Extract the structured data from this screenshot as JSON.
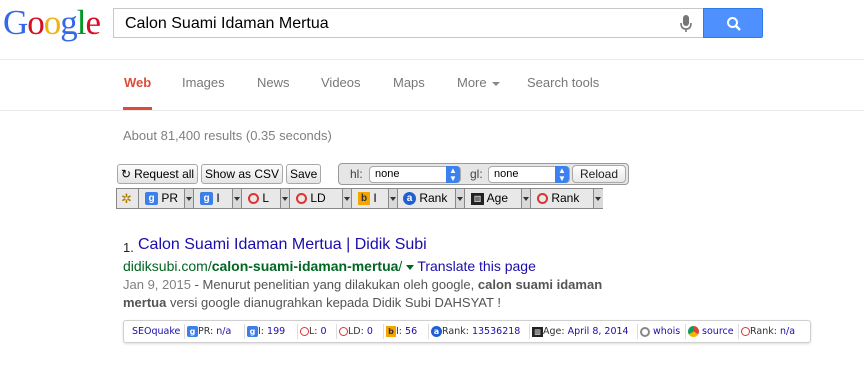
{
  "logo": {
    "letters": [
      "G",
      "o",
      "o",
      "g",
      "l",
      "e"
    ],
    "colors": [
      "#3369e8",
      "#d50f25",
      "#eeb211",
      "#3369e8",
      "#009925",
      "#d50f25"
    ]
  },
  "search": {
    "query": "Calon Suami Idaman Mertua"
  },
  "tabs": [
    {
      "label": "Web",
      "active": true
    },
    {
      "label": "Images"
    },
    {
      "label": "News"
    },
    {
      "label": "Videos"
    },
    {
      "label": "Maps"
    },
    {
      "label": "More"
    },
    {
      "label": "Search tools"
    }
  ],
  "result_stats": "About 81,400 results (0.35 seconds)",
  "seoquake_toolbar": {
    "request_all": "Request all",
    "show_csv": "Show as CSV",
    "save": "Save",
    "hl_label": "hl:",
    "hl_value": "none",
    "gl_label": "gl:",
    "gl_value": "none",
    "reload": "Reload"
  },
  "param_bar": {
    "pr": "PR",
    "i1": "I",
    "l": "L",
    "ld": "LD",
    "i2": "I",
    "rank1": "Rank",
    "age": "Age",
    "rank2": "Rank"
  },
  "result": {
    "number": "1.",
    "title": "Calon Suami Idaman Mertua | Didik Subi",
    "url_domain": "didiksubi.com/",
    "url_path": "calon-suami-idaman-mertua",
    "url_suffix": "/",
    "translate": "Translate this page",
    "date": "Jan 9, 2015",
    "snippet_1": " - Menurut penelitian yang dilakukan oleh google, ",
    "snippet_bold_1": "calon suami idaman",
    "snippet_bold_2": "mertua",
    "snippet_2": " versi google dianugrahkan kepada Didik Subi DAHSYAT !"
  },
  "seoquake_bar": {
    "brand": "SEOquake",
    "pr_label": "PR: ",
    "pr_value": "n/a",
    "i_label": "I: ",
    "i_value": "199",
    "l_label": "L: ",
    "l_value": "0",
    "ld_label": "LD: ",
    "ld_value": "0",
    "i2_label": "I: ",
    "i2_value": "56",
    "rank_label": "Rank: ",
    "rank_value": "13536218",
    "age_label": "Age: ",
    "age_value": "April 8, 2014",
    "whois": "whois",
    "source": "source",
    "rank2_label": "Rank: ",
    "rank2_value": "n/a"
  }
}
